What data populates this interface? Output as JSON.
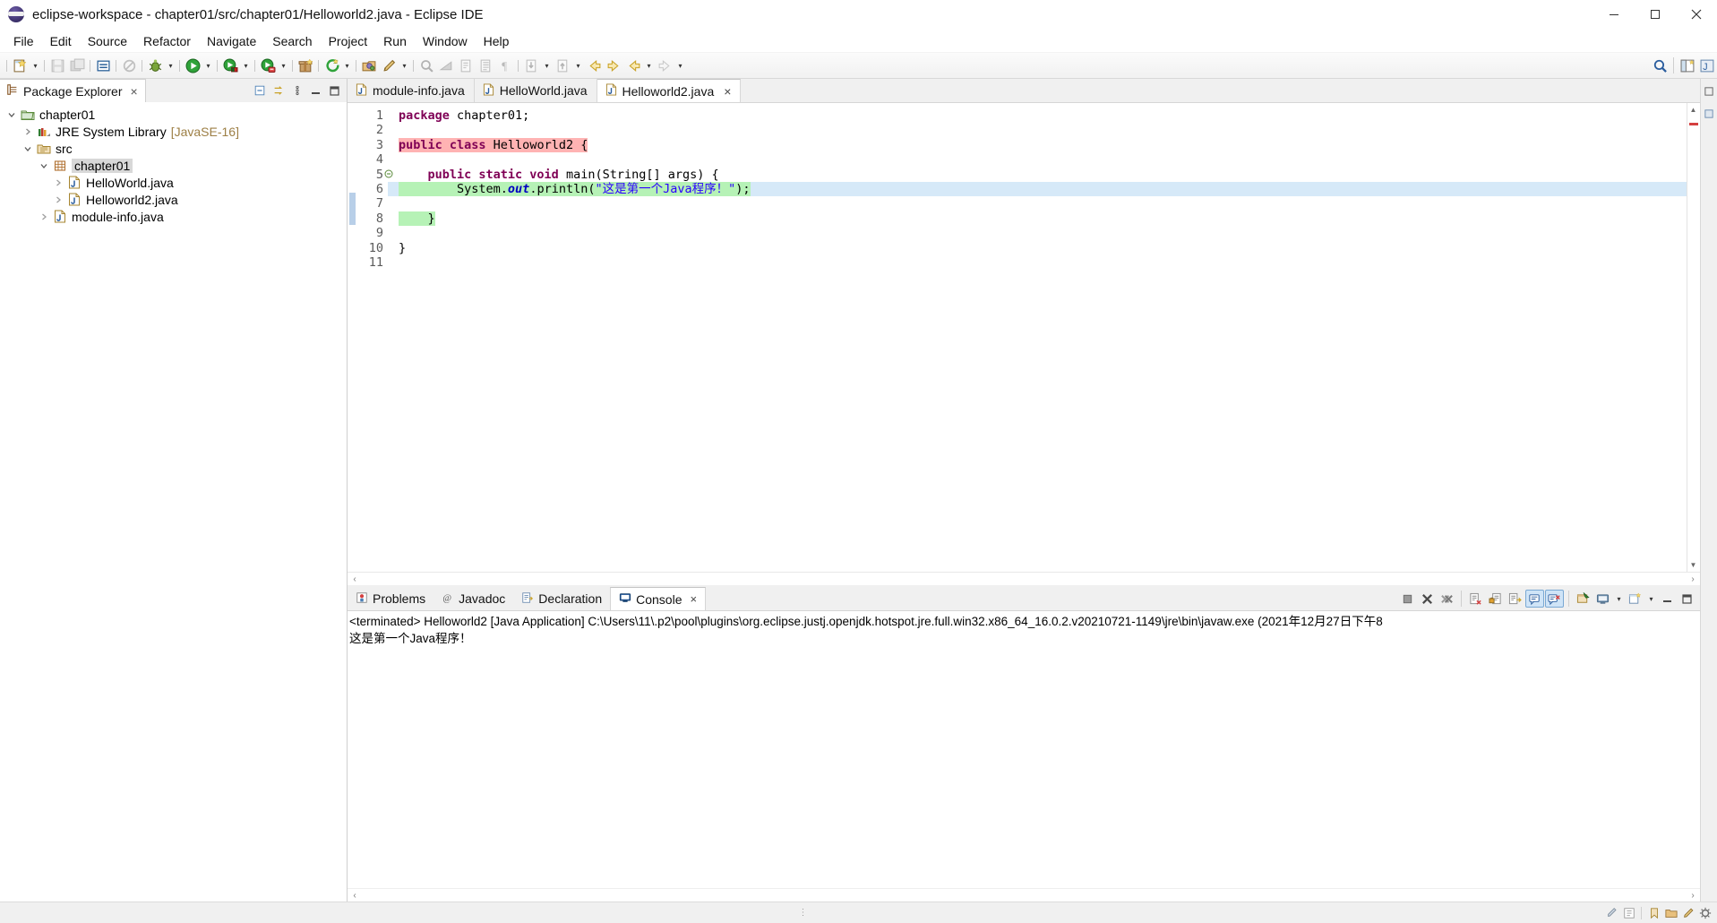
{
  "window": {
    "title": "eclipse-workspace - chapter01/src/chapter01/Helloworld2.java - Eclipse IDE",
    "minimize_label": "Minimize",
    "maximize_label": "Maximize",
    "close_label": "Close"
  },
  "menubar": {
    "items": [
      {
        "label": "File"
      },
      {
        "label": "Edit"
      },
      {
        "label": "Source"
      },
      {
        "label": "Refactor"
      },
      {
        "label": "Navigate"
      },
      {
        "label": "Search"
      },
      {
        "label": "Project"
      },
      {
        "label": "Run"
      },
      {
        "label": "Window"
      },
      {
        "label": "Help"
      }
    ]
  },
  "toolbar": {
    "buttons": [
      {
        "name": "new-wizard",
        "icon": "new-file-icon"
      },
      {
        "name": "save",
        "icon": "save-icon"
      },
      {
        "name": "save-all",
        "icon": "save-all-icon"
      },
      {
        "name": "new-java-package",
        "icon": "package-icon"
      },
      {
        "name": "link-with-editor",
        "icon": "link-icon"
      },
      {
        "name": "debug",
        "icon": "bug-icon"
      },
      {
        "name": "run",
        "icon": "run-green-icon"
      },
      {
        "name": "coverage",
        "icon": "coverage-icon"
      },
      {
        "name": "run-error",
        "icon": "run-error-icon"
      },
      {
        "name": "new-java-project",
        "icon": "gift-icon"
      },
      {
        "name": "external-tools",
        "icon": "external-tools-icon"
      },
      {
        "name": "open-type",
        "icon": "open-type-icon"
      },
      {
        "name": "edit-marker",
        "icon": "pen-icon"
      },
      {
        "name": "search-dialog",
        "icon": "search-magnifier-icon"
      },
      {
        "name": "skip-breakpoints",
        "icon": "skip-icon"
      },
      {
        "name": "next-annotation",
        "icon": "next-annotation-icon"
      },
      {
        "name": "previous-annotation",
        "icon": "prev-annotation-icon"
      },
      {
        "name": "pilcrow",
        "icon": "pilcrow-icon"
      },
      {
        "name": "step-into",
        "icon": "step-into-icon"
      },
      {
        "name": "step-return",
        "icon": "step-return-icon"
      },
      {
        "name": "back",
        "icon": "back-arrow-icon"
      },
      {
        "name": "forward",
        "icon": "forward-arrow-icon"
      },
      {
        "name": "last-edit",
        "icon": "last-edit-icon"
      },
      {
        "name": "pin",
        "icon": "pin-icon"
      }
    ],
    "right_buttons": [
      {
        "name": "quick-access-search",
        "icon": "search-icon"
      },
      {
        "name": "open-perspective",
        "icon": "open-perspective-icon"
      },
      {
        "name": "java-perspective",
        "icon": "java-perspective-icon"
      }
    ]
  },
  "package_explorer": {
    "tab_label": "Package Explorer",
    "close_label": "×",
    "tools": [
      {
        "name": "collapse-all-button",
        "icon": "collapse-all-icon"
      },
      {
        "name": "link-with-editor-button",
        "icon": "link-editor-icon"
      },
      {
        "name": "view-menu-button",
        "icon": "view-menu-icon"
      },
      {
        "name": "minimize-view-button",
        "icon": "minimize-icon"
      },
      {
        "name": "maximize-view-button",
        "icon": "maximize-icon"
      }
    ],
    "tree": [
      {
        "label": "chapter01",
        "sub": "",
        "depth": 0,
        "twisty": "down",
        "icon": "java-project-icon",
        "selected": false
      },
      {
        "label": "JRE System Library",
        "sub": "[JavaSE-16]",
        "depth": 1,
        "twisty": "right",
        "icon": "library-icon",
        "selected": false
      },
      {
        "label": "src",
        "sub": "",
        "depth": 1,
        "twisty": "down",
        "icon": "source-folder-icon",
        "selected": false
      },
      {
        "label": "chapter01",
        "sub": "",
        "depth": 2,
        "twisty": "down",
        "icon": "package-icon",
        "selected": true
      },
      {
        "label": "HelloWorld.java",
        "sub": "",
        "depth": 3,
        "twisty": "right",
        "icon": "java-file-icon",
        "selected": false
      },
      {
        "label": "Helloworld2.java",
        "sub": "",
        "depth": 3,
        "twisty": "right",
        "icon": "java-file-icon",
        "selected": false
      },
      {
        "label": "module-info.java",
        "sub": "",
        "depth": 2,
        "twisty": "right",
        "icon": "java-file-icon",
        "selected": false
      }
    ]
  },
  "editor": {
    "tabs": [
      {
        "label": "module-info.java",
        "active": false,
        "closable": false
      },
      {
        "label": "HelloWorld.java",
        "active": false,
        "closable": false
      },
      {
        "label": "Helloworld2.java",
        "active": true,
        "closable": true
      }
    ],
    "close_label": "×",
    "line_numbers": [
      "1",
      "2",
      "3",
      "4",
      "5",
      "6",
      "7",
      "8",
      "9",
      "10",
      "11"
    ],
    "lines": [
      {
        "n": 1,
        "segments": [
          {
            "t": "package",
            "c": "kw"
          },
          {
            "t": " chapter01;",
            "c": "plain"
          }
        ],
        "highlight": "",
        "current": false,
        "fold": ""
      },
      {
        "n": 2,
        "segments": [],
        "highlight": "",
        "current": false,
        "fold": ""
      },
      {
        "n": 3,
        "segments": [
          {
            "t": "public class",
            "c": "kw"
          },
          {
            "t": " Helloworld2 {",
            "c": "plain"
          }
        ],
        "highlight": "red",
        "current": false,
        "fold": ""
      },
      {
        "n": 4,
        "segments": [],
        "highlight": "",
        "current": false,
        "fold": ""
      },
      {
        "n": 5,
        "segments": [
          {
            "t": "    ",
            "c": "plain"
          },
          {
            "t": "public static void",
            "c": "kw"
          },
          {
            "t": " main(String[] args) {",
            "c": "plain"
          }
        ],
        "highlight": "",
        "current": false,
        "fold": "minus"
      },
      {
        "n": 6,
        "segments": [
          {
            "t": "        System.",
            "c": "plain"
          },
          {
            "t": "out",
            "c": "fld"
          },
          {
            "t": ".println(",
            "c": "plain"
          },
          {
            "t": "\"这是第一个Java程序！\"",
            "c": "str"
          },
          {
            "t": ");",
            "c": "plain"
          }
        ],
        "highlight": "green",
        "current": true,
        "fold": ""
      },
      {
        "n": 7,
        "segments": [],
        "highlight": "",
        "current": false,
        "fold": ""
      },
      {
        "n": 8,
        "segments": [
          {
            "t": "    }",
            "c": "plain"
          }
        ],
        "highlight": "green",
        "current": false,
        "fold": ""
      },
      {
        "n": 9,
        "segments": [],
        "highlight": "",
        "current": false,
        "fold": ""
      },
      {
        "n": 10,
        "segments": [
          {
            "t": "}",
            "c": "plain"
          }
        ],
        "highlight": "",
        "current": false,
        "fold": ""
      },
      {
        "n": 11,
        "segments": [],
        "highlight": "",
        "current": false,
        "fold": ""
      }
    ]
  },
  "bottom_panel": {
    "tabs": [
      {
        "label": "Problems",
        "icon": "problems-icon",
        "active": false,
        "closable": false
      },
      {
        "label": "Javadoc",
        "icon": "javadoc-icon",
        "active": false,
        "closable": false
      },
      {
        "label": "Declaration",
        "icon": "declaration-icon",
        "active": false,
        "closable": false
      },
      {
        "label": "Console",
        "icon": "console-icon",
        "active": true,
        "closable": true
      }
    ],
    "close_label": "×",
    "tools": [
      {
        "name": "terminate-button",
        "icon": "terminate-icon",
        "active": false
      },
      {
        "name": "remove-launch-button",
        "icon": "remove-icon",
        "active": false
      },
      {
        "name": "remove-all-terminated-button",
        "icon": "remove-all-icon",
        "active": false
      },
      {
        "name": "clear-console-button",
        "icon": "clear-console-icon",
        "active": false
      },
      {
        "name": "lock-scroll-button",
        "icon": "lock-scroll-icon",
        "active": false
      },
      {
        "name": "scroll-lock-button",
        "icon": "scroll-lock-icon",
        "active": false
      },
      {
        "name": "show-console-on-output-button",
        "icon": "show-on-output-icon",
        "active": true
      },
      {
        "name": "show-console-on-error-button",
        "icon": "show-on-error-icon",
        "active": true
      },
      {
        "name": "pin-console-button",
        "icon": "pin-console-icon",
        "active": false
      },
      {
        "name": "display-selected-console-button",
        "icon": "display-console-icon",
        "active": false
      },
      {
        "name": "open-console-button",
        "icon": "open-console-icon",
        "active": false
      },
      {
        "name": "minimize-panel-button",
        "icon": "minimize-icon",
        "active": false
      },
      {
        "name": "maximize-panel-button",
        "icon": "maximize-icon",
        "active": false
      }
    ],
    "console": {
      "header": "<terminated> Helloworld2 [Java Application] C:\\Users\\11\\.p2\\pool\\plugins\\org.eclipse.justj.openjdk.hotspot.jre.full.win32.x86_64_16.0.2.v20210721-1149\\jre\\bin\\javaw.exe  (2021年12月27日下午8",
      "output": "这是第一个Java程序！"
    }
  },
  "statusbar": {
    "dots": "⋮",
    "items": [
      {
        "name": "writable-indicator",
        "icon": "writable-icon"
      },
      {
        "name": "smart-insert-indicator",
        "icon": "insert-mode-icon"
      },
      {
        "name": "bookmark-indicator",
        "icon": "bookmark-icon"
      },
      {
        "name": "folder-indicator",
        "icon": "folder-icon"
      },
      {
        "name": "edit-indicator",
        "icon": "pencil-icon"
      },
      {
        "name": "build-indicator",
        "icon": "build-icon"
      }
    ]
  },
  "colors": {
    "accent": "#2a00ff",
    "keyword": "#7f0055",
    "string": "#2a00ff",
    "field": "#0000c0",
    "error_highlight": "#ffb3b3",
    "ok_highlight": "#b6f2b6",
    "current_line": "#d6e9f8",
    "selection_gray": "#d8d8d8",
    "jre_sub": "#9d7f45"
  }
}
